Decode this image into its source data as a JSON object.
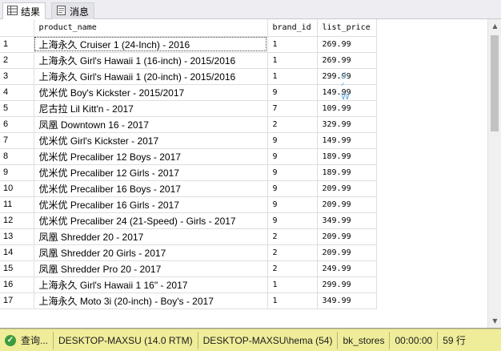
{
  "tabs": [
    {
      "label": "结果",
      "icon": "grid-icon",
      "active": true
    },
    {
      "label": "消息",
      "icon": "message-icon",
      "active": false
    }
  ],
  "grid": {
    "columns": [
      "",
      "product_name",
      "brand_id",
      "list_price"
    ],
    "selected_row": 0,
    "rows": [
      [
        "1",
        "上海永久 Cruiser 1 (24-Inch) - 2016",
        "1",
        "269.99"
      ],
      [
        "2",
        "上海永久 Girl's Hawaii 1 (16-inch) - 2015/2016",
        "1",
        "269.99"
      ],
      [
        "3",
        "上海永久 Girl's Hawaii 1 (20-inch) - 2015/2016",
        "1",
        "299.99"
      ],
      [
        "4",
        "优米优 Boy's Kickster - 2015/2017",
        "9",
        "149.99"
      ],
      [
        "5",
        "尼古拉 Lil Kitt'n - 2017",
        "7",
        "109.99"
      ],
      [
        "6",
        "凤凰 Downtown 16 - 2017",
        "2",
        "329.99"
      ],
      [
        "7",
        "优米优 Girl's Kickster - 2017",
        "9",
        "149.99"
      ],
      [
        "8",
        "优米优 Precaliber 12 Boys - 2017",
        "9",
        "189.99"
      ],
      [
        "9",
        "优米优 Precaliber 12 Girls - 2017",
        "9",
        "189.99"
      ],
      [
        "10",
        "优米优 Precaliber 16 Boys - 2017",
        "9",
        "209.99"
      ],
      [
        "11",
        "优米优 Precaliber 16 Girls - 2017",
        "9",
        "209.99"
      ],
      [
        "12",
        "优米优 Precaliber 24 (21-Speed) - Girls - 2017",
        "9",
        "349.99"
      ],
      [
        "13",
        "凤凰 Shredder 20 - 2017",
        "2",
        "209.99"
      ],
      [
        "14",
        "凤凰 Shredder 20 Girls - 2017",
        "2",
        "209.99"
      ],
      [
        "15",
        "凤凰 Shredder Pro 20 - 2017",
        "2",
        "249.99"
      ],
      [
        "16",
        "上海永久 Girl's Hawaii 1 16\" - 2017",
        "1",
        "299.99"
      ],
      [
        "17",
        "上海永久 Moto 3i (20-inch) - Boy's - 2017",
        "1",
        "349.99"
      ]
    ]
  },
  "status": {
    "query": "查询...",
    "server": "DESKTOP-MAXSU (14.0 RTM)",
    "user": "DESKTOP-MAXSU\\hema (54)",
    "database": "bk_stores",
    "elapsed": "00:00:00",
    "rows": "59 行"
  }
}
